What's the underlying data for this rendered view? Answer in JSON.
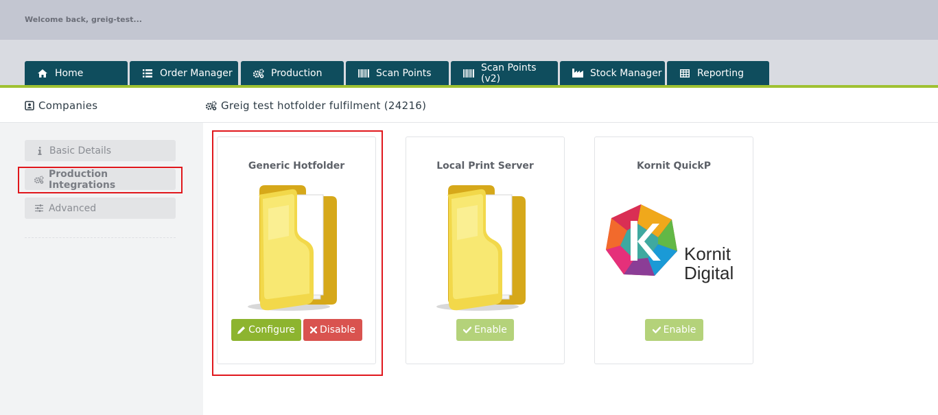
{
  "header": {
    "welcome": "Welcome back, greig-test..."
  },
  "nav": {
    "tabs": [
      {
        "label": "Home",
        "icon": "home-icon"
      },
      {
        "label": "Order Manager",
        "icon": "list-icon"
      },
      {
        "label": "Production",
        "icon": "cogs-icon"
      },
      {
        "label": "Scan Points",
        "icon": "barcode-icon"
      },
      {
        "label": "Scan Points (v2)",
        "icon": "barcode-icon"
      },
      {
        "label": "Stock Manager",
        "icon": "industry-icon"
      },
      {
        "label": "Reporting",
        "icon": "table-icon"
      }
    ]
  },
  "subheader": {
    "left_title": "Companies",
    "right_title": "Greig test hotfolder fulfilment (24216)"
  },
  "sidebar": {
    "items": [
      {
        "label": "Basic Details",
        "icon": "info-icon"
      },
      {
        "label": "Production Integrations",
        "icon": "cogs-icon"
      },
      {
        "label": "Advanced",
        "icon": "sliders-icon"
      }
    ]
  },
  "integrations": [
    {
      "title": "Generic Hotfolder",
      "image": "folder-icon",
      "buttons": [
        "Configure",
        "Disable"
      ]
    },
    {
      "title": "Local Print Server",
      "image": "folder-icon",
      "buttons": [
        "Enable"
      ]
    },
    {
      "title": "Kornit QuickP",
      "image": "kornit-logo",
      "logo_text": [
        "Kornit",
        "Digital"
      ],
      "buttons": [
        "Enable"
      ]
    }
  ],
  "colors": {
    "nav_bg": "#0f4d5d",
    "accent_green": "#9fc131",
    "configure_green": "#8db42f",
    "disable_red": "#d9534f",
    "enable_green": "#b4d27a",
    "highlight_red": "#e0161b"
  }
}
